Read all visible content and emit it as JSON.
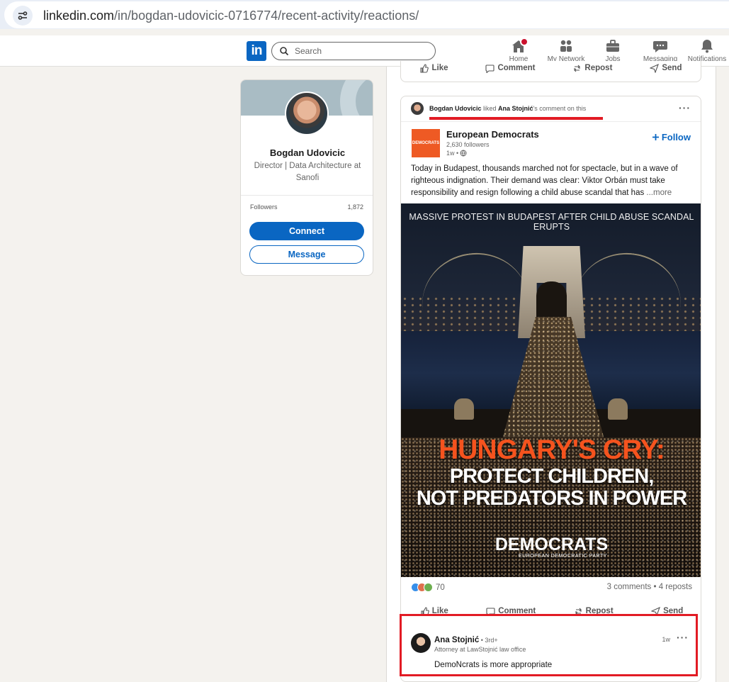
{
  "browser": {
    "url_host": "linkedin.com",
    "url_path": "/in/bogdan-udovicic-0716774/recent-activity/reactions/"
  },
  "nav": {
    "logo": "in",
    "search_placeholder": "Search",
    "items": [
      {
        "label": "Home",
        "icon": "home-icon"
      },
      {
        "label": "My Network",
        "icon": "network-icon"
      },
      {
        "label": "Jobs",
        "icon": "briefcase-icon"
      },
      {
        "label": "Messaging",
        "icon": "messaging-icon"
      },
      {
        "label": "Notifications",
        "icon": "bell-icon"
      }
    ]
  },
  "profile": {
    "name": "Bogdan Udovicic",
    "headline": "Director | Data Architecture at Sanofi",
    "followers_label": "Followers",
    "followers_count": "1,872",
    "connect_label": "Connect",
    "message_label": "Message"
  },
  "actions": {
    "like": "Like",
    "comment": "Comment",
    "repost": "Repost",
    "send": "Send"
  },
  "post": {
    "activity": {
      "actor": "Bogdan Udovicic",
      "verb": " liked ",
      "target": "Ana Stojnić",
      "suffix": "'s comment on this"
    },
    "company": {
      "name": "European Democrats",
      "logo_text": "DEMOCRATS",
      "followers": "2,630 followers",
      "time": "1w •"
    },
    "follow_label": "Follow",
    "text": "Today in Budapest, thousands marched not for spectacle, but in a wave of righteous indignation. Their demand was clear: Viktor Orbán must take responsibility and resign following a child abuse scandal that has ",
    "more_label": "...more",
    "image": {
      "top_caption": "MASSIVE PROTEST IN BUDAPEST AFTER CHILD ABUSE SCANDAL ERUPTS",
      "headline": "HUNGARY'S CRY:",
      "sub_line1": "PROTECT CHILDREN,",
      "sub_line2": "NOT PREDATORS IN POWER",
      "brand": "DEMOCRATS",
      "brand_sub": "EUROPEAN DEMOCRATIC PARTY"
    },
    "reactions_count": "70",
    "comments_reposts": "3 comments • 4 reposts"
  },
  "comment": {
    "author": "Ana Stojnić",
    "degree": " • 3rd+",
    "title": "Attorney at LawStojnić law office",
    "time": "1w",
    "text": "DemoNcrats is more appropriate"
  },
  "colors": {
    "linkedin_blue": "#0a66c2",
    "highlight_red": "#e21b24",
    "headline_orange": "#f5531e"
  }
}
